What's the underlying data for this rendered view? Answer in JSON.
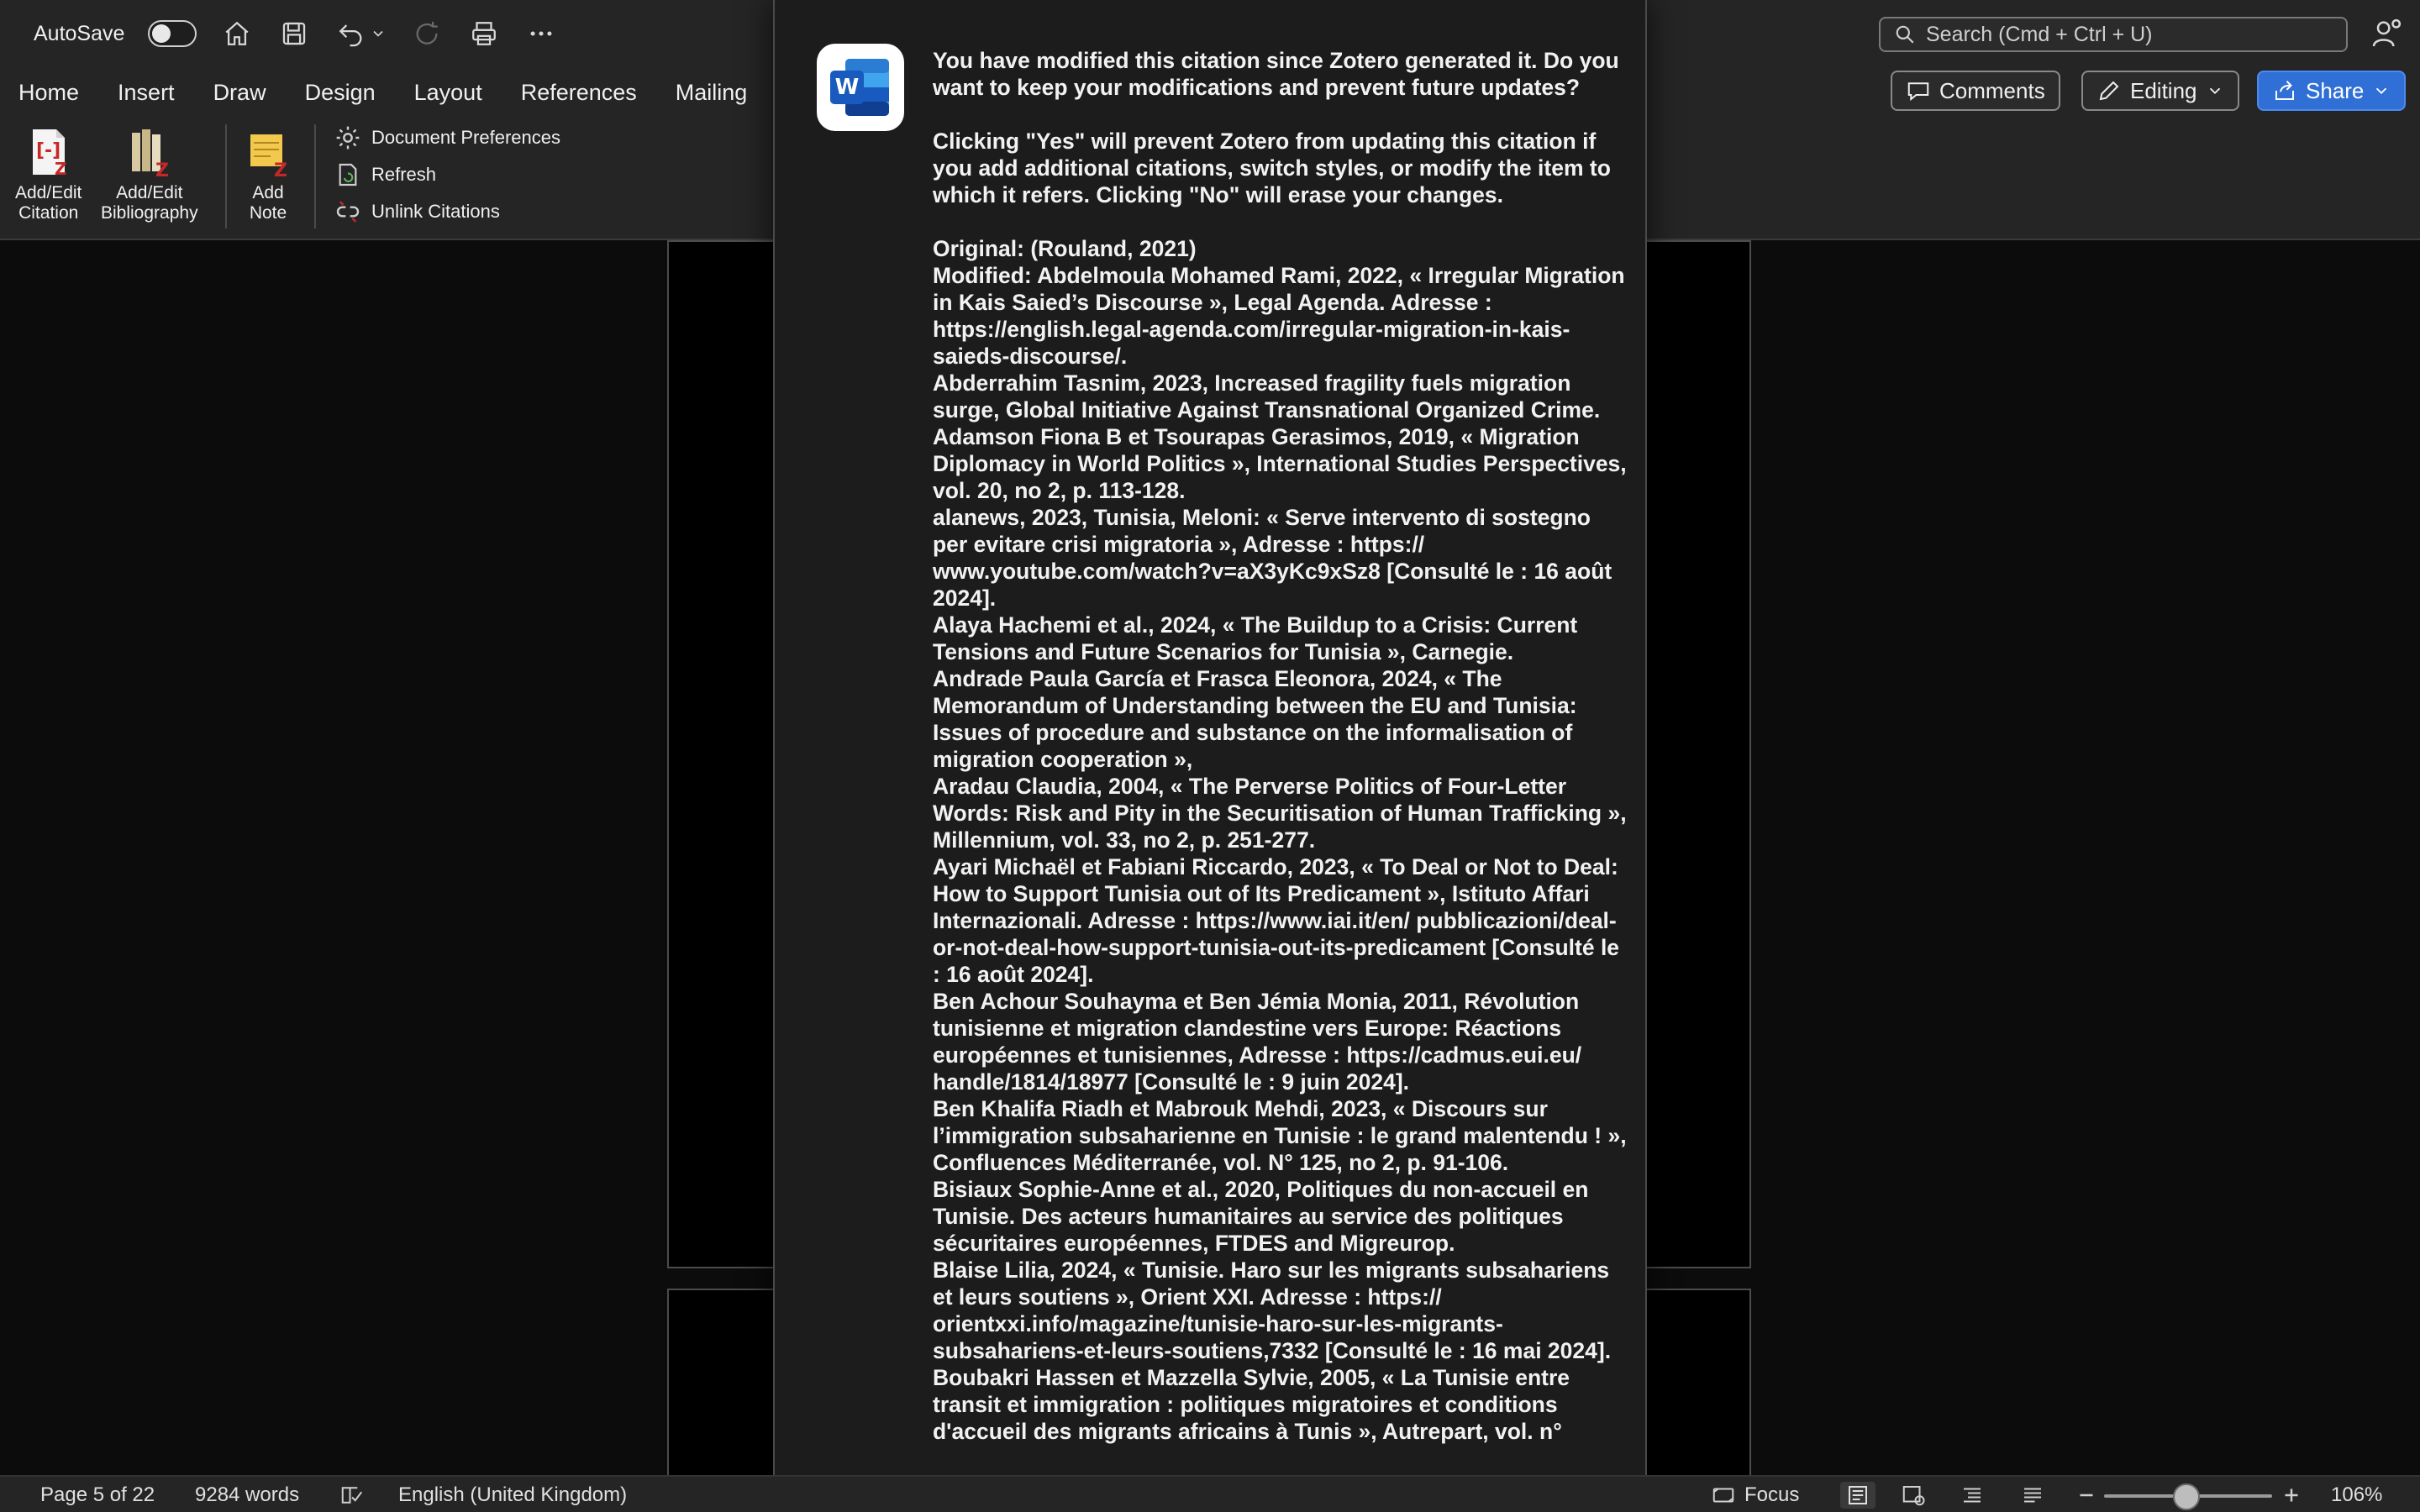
{
  "titlebar": {
    "autosave_label": "AutoSave",
    "search_placeholder": "Search (Cmd + Ctrl + U)"
  },
  "ribbon": {
    "tabs": [
      "Home",
      "Insert",
      "Draw",
      "Design",
      "Layout",
      "References",
      "Mailing"
    ],
    "comments_label": "Comments",
    "editing_label": "Editing",
    "share_label": "Share",
    "zotero": {
      "add_edit_citation": [
        "Add/Edit",
        "Citation"
      ],
      "add_edit_bibliography": [
        "Add/Edit",
        "Bibliography"
      ],
      "add_note": [
        "Add",
        "Note"
      ],
      "document_preferences": "Document Preferences",
      "refresh": "Refresh",
      "unlink_citations": "Unlink Citations"
    }
  },
  "dialog": {
    "app_icon_letter": "W",
    "question": "You have modified this citation since Zotero generated it. Do you want to keep your modifications and prevent future updates?",
    "explanation": "Clicking \"Yes\" will prevent Zotero from updating this citation if you add additional citations, switch styles, or modify the item to which it refers. Clicking \"No\" will erase your changes.",
    "original": "Original: (Rouland, 2021)",
    "modified_lines": [
      "Modified: Abdelmoula Mohamed Rami, 2022, « Irregular Migration in Kais Saied’s Discourse », Legal Agenda. Adresse : https://english.legal-agenda.com/irregular-migration-in-kais-saieds-discourse/.",
      "Abderrahim Tasnim, 2023, Increased fragility fuels migration surge, Global Initiative Against Transnational Organized Crime.",
      "Adamson Fiona B et Tsourapas Gerasimos, 2019, « Migration Diplomacy in World Politics », International Studies Perspectives, vol. 20, no 2, p. 113-128.",
      "alanews, 2023, Tunisia, Meloni: « Serve intervento di sostegno per evitare crisi migratoria », Adresse : https:// www.youtube.com/watch?v=aX3yKc9xSz8 [Consulté le : 16 août 2024].",
      "Alaya Hachemi et al., 2024, « The Buildup to a Crisis: Current Tensions and Future Scenarios for Tunisia », Carnegie.",
      "Andrade Paula García et Frasca Eleonora, 2024, « The Memorandum of Understanding between the EU and Tunisia: Issues of procedure and substance on the informalisation of migration cooperation »,",
      "Aradau Claudia, 2004, « The Perverse Politics of Four-Letter Words: Risk and Pity in the Securitisation of Human Trafficking », Millennium, vol. 33, no 2, p. 251-277.",
      "Ayari Michaël et Fabiani Riccardo, 2023, « To Deal or Not to Deal: How to Support Tunisia out of Its Predicament », Istituto Affari Internazionali. Adresse : https://www.iai.it/en/ pubblicazioni/deal-or-not-deal-how-support-tunisia-out-its-predicament [Consulté le : 16 août 2024].",
      "Ben Achour Souhayma et Ben Jémia Monia, 2011, Révolution tunisienne et migration clandestine vers Europe: Réactions européennes et tunisiennes, Adresse : https://cadmus.eui.eu/ handle/1814/18977 [Consulté le : 9 juin 2024].",
      "Ben Khalifa Riadh et Mabrouk Mehdi, 2023, « Discours sur l’immigration subsaharienne en Tunisie : le grand malentendu ! », Confluences Méditerranée, vol. N° 125, no 2, p. 91-106.",
      "Bisiaux Sophie-Anne et al., 2020, Politiques du non-accueil en Tunisie. Des acteurs humanitaires au service des politiques sécuritaires européennes, FTDES and Migreurop.",
      "Blaise Lilia, 2024, « Tunisie. Haro sur les migrants subsahariens et leurs soutiens », Orient XXI. Adresse : https:// orientxxi.info/magazine/tunisie-haro-sur-les-migrants-subsahariens-et-leurs-soutiens,7332 [Consulté le : 16 mai 2024].",
      "Boubakri Hassen et Mazzella Sylvie, 2005, « La Tunisie entre transit et immigration : politiques migratoires et conditions d'accueil des migrants africains à Tunis », Autrepart, vol. n°"
    ]
  },
  "statusbar": {
    "page": "Page 5 of 22",
    "words": "9284 words",
    "language": "English (United Kingdom)",
    "focus": "Focus",
    "zoom": "106%",
    "zoom_level_percent": 106
  },
  "colors": {
    "chrome": "#252525",
    "document_bg": "#0c0c0c",
    "page": "#000000",
    "dialog": "#1c1c1c",
    "share_accent": "#2f6fd6",
    "zotero_red": "#c62828"
  }
}
